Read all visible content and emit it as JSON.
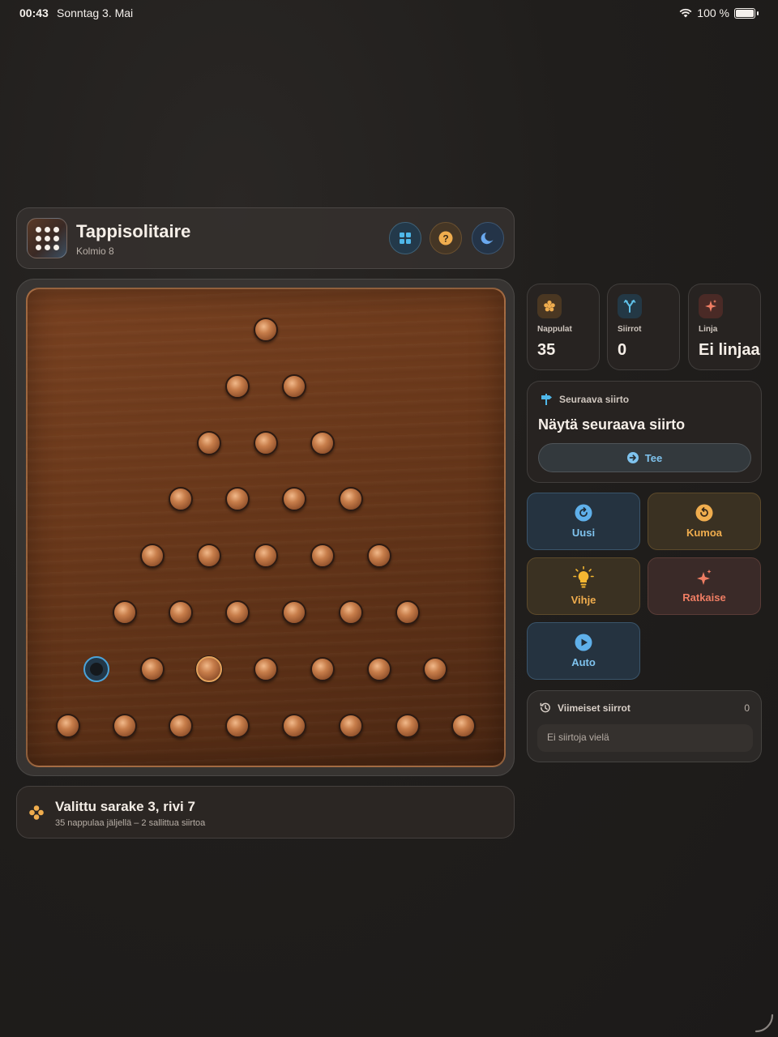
{
  "status_bar": {
    "time": "00:43",
    "date": "Sonntag 3. Mai",
    "battery": "100 %"
  },
  "header": {
    "title": "Tappisolitaire",
    "subtitle": "Kolmio 8",
    "buttons": [
      {
        "name": "grid",
        "icon": "grid-icon",
        "color": "#4fb8ea"
      },
      {
        "name": "help",
        "icon": "question-icon",
        "color": "#f0ad4e"
      },
      {
        "name": "theme",
        "icon": "moon-icon",
        "color": "#6aa9f0"
      }
    ]
  },
  "board": {
    "type": "triangle",
    "rows": 8,
    "peg_counts_per_row": [
      1,
      2,
      3,
      4,
      5,
      6,
      7,
      8
    ],
    "empty_hole": {
      "row": 7,
      "col": 1
    },
    "selected_peg": {
      "row": 7,
      "col": 3
    }
  },
  "info": {
    "title": "Valittu sarake 3, rivi 7",
    "subtitle": "35 nappulaa jäljellä – 2 sallittua siirtoa"
  },
  "stats": [
    {
      "label": "Nappulat",
      "value": "35",
      "icon": "pegs-icon",
      "color": "#f0ad4e"
    },
    {
      "label": "Siirrot",
      "value": "0",
      "icon": "moves-icon",
      "color": "#5fc0e8"
    },
    {
      "label": "Linja",
      "value": "Ei linjaa",
      "icon": "sparkle-icon",
      "color": "#ef7d63"
    }
  ],
  "next_move": {
    "heading": "Seuraava siirto",
    "title": "Näytä seuraava siirto",
    "button": "Tee"
  },
  "actions": {
    "new": "Uusi",
    "undo": "Kumoa",
    "hint": "Vihje",
    "solve": "Ratkaise",
    "auto": "Auto"
  },
  "recent": {
    "heading": "Viimeiset siirrot",
    "count": "0",
    "empty": "Ei siirtoja vielä"
  },
  "colors": {
    "accent_blue": "#7fc3ee",
    "accent_amber": "#f0ad4e",
    "accent_red": "#ef7d63",
    "board_wood": "#6b391b"
  }
}
